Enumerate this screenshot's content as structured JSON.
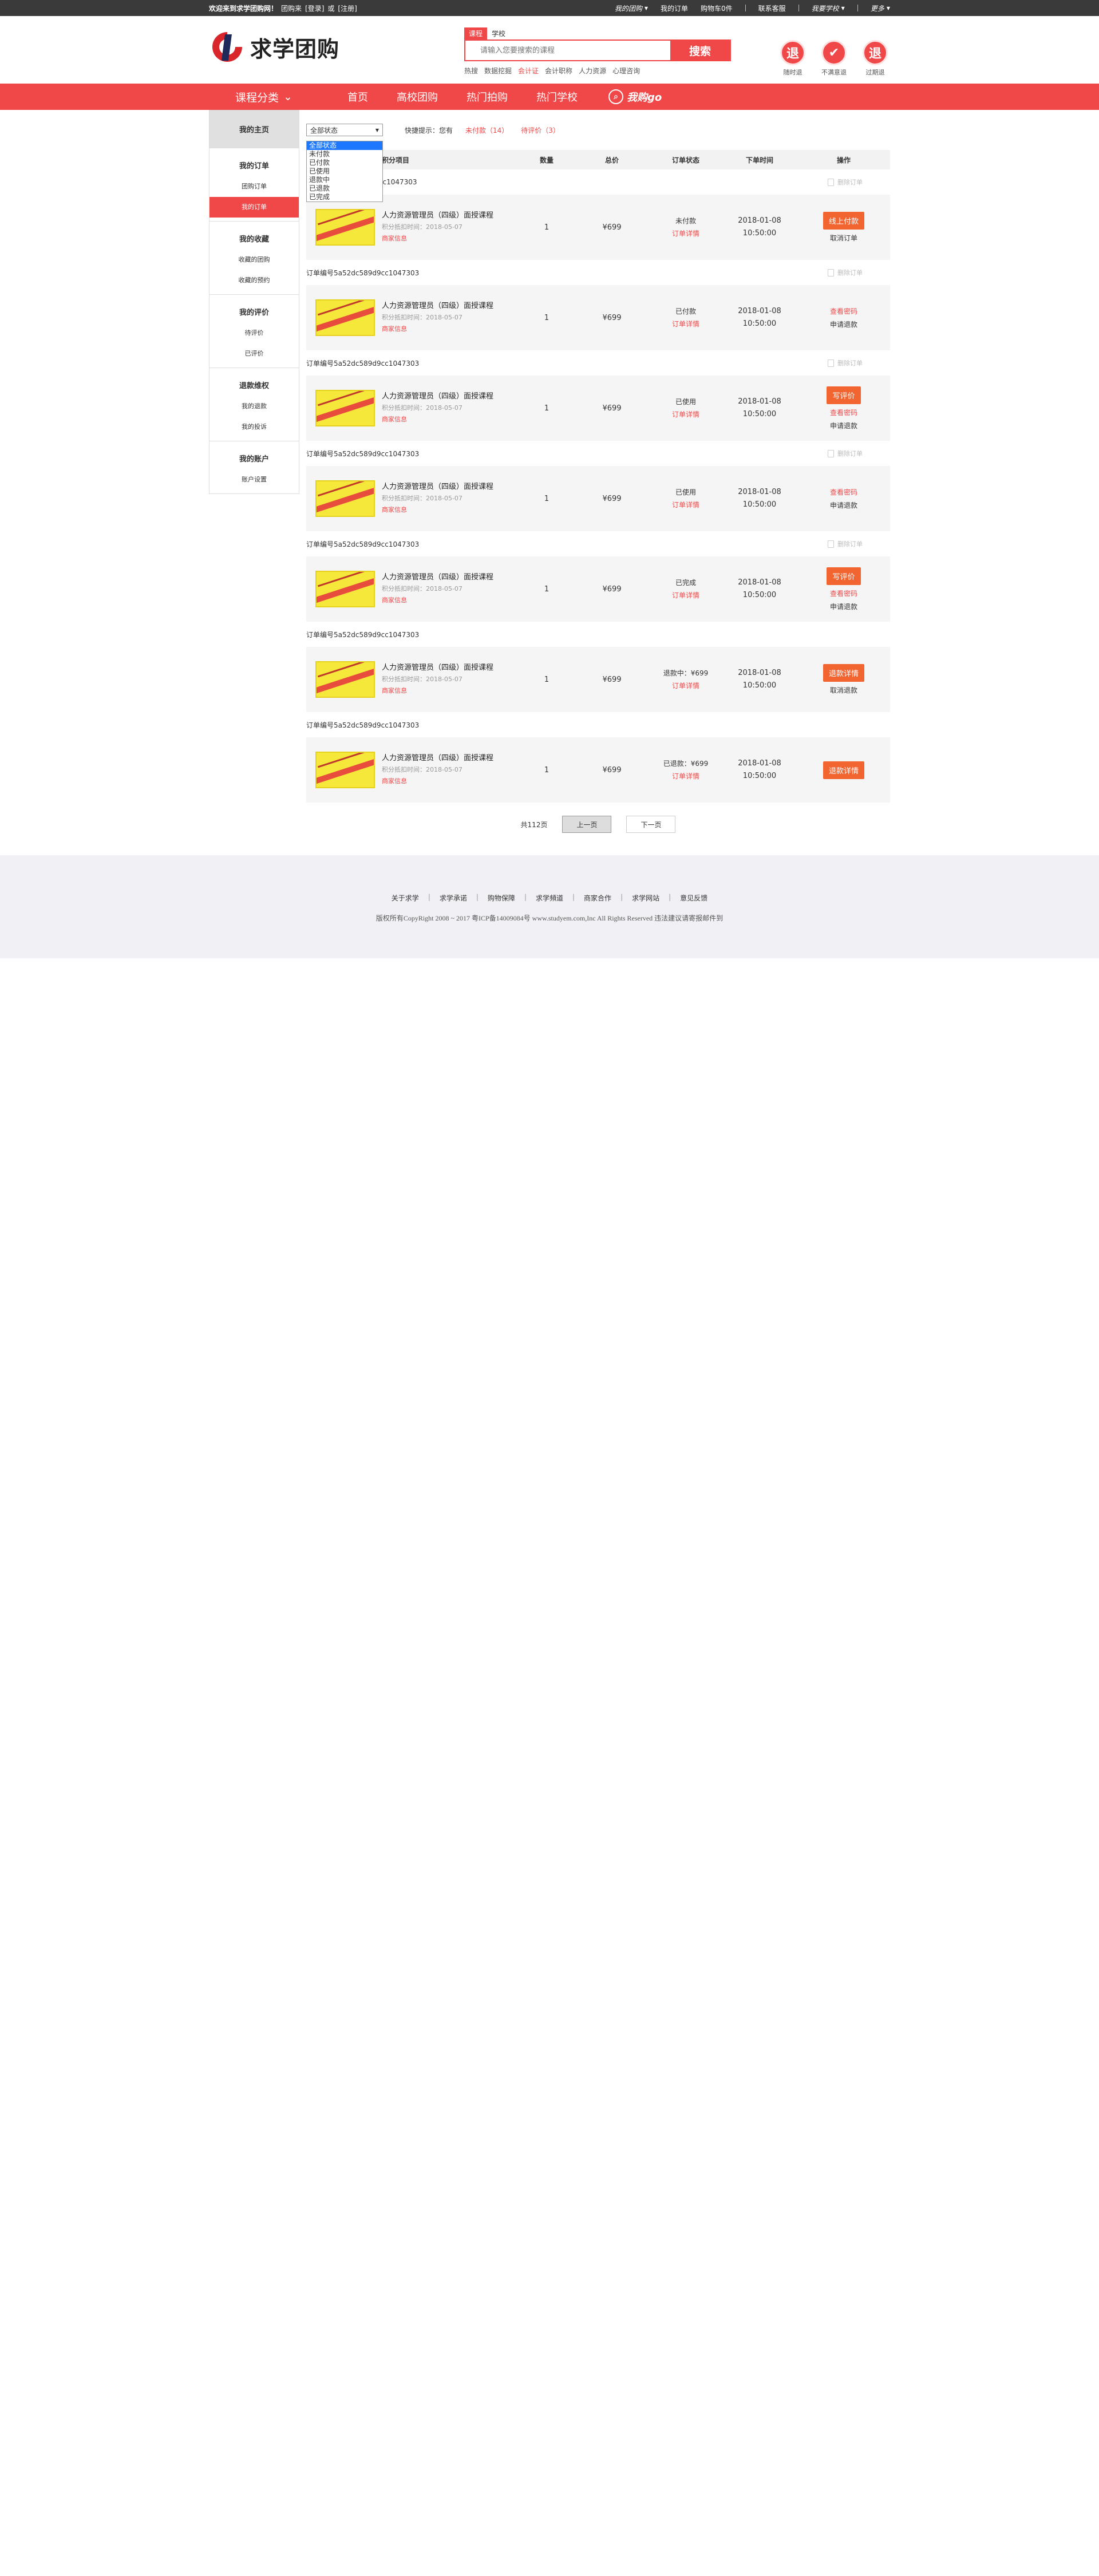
{
  "topbar": {
    "welcome": "欢迎来到求学团购网！",
    "group": "团购来",
    "login": "[登录]",
    "or": "或",
    "register": "[注册]",
    "links": [
      "我的团购",
      "我的订单",
      "购物车0件",
      "联系客服",
      "我要学校",
      "更多"
    ]
  },
  "header": {
    "logo": "求学团购",
    "search": {
      "tab_course": "课程",
      "tab_school": "学校",
      "placeholder": "请输入您要搜索的课程",
      "button": "搜索",
      "hot_label": "热搜",
      "hot": [
        "数据挖掘",
        "会计证",
        "会计职称",
        "人力资源",
        "心理咨询"
      ]
    },
    "badges": [
      "随时退",
      "不满意退",
      "过期退"
    ],
    "badge_glyphs": [
      "退",
      "✔",
      "退"
    ]
  },
  "nav": {
    "category": "课程分类",
    "items": [
      "首页",
      "高校团购",
      "热门拍购",
      "热门学校"
    ],
    "brand": "我购go"
  },
  "sidebar": {
    "home": "我的主页",
    "groups": [
      {
        "title": "我的订单",
        "items": [
          "团购订单",
          "我的订单"
        ]
      },
      {
        "title": "我的收藏",
        "items": [
          "收藏的团购",
          "收藏的预约"
        ]
      },
      {
        "title": "我的评价",
        "items": [
          "待评价",
          "已评价"
        ]
      },
      {
        "title": "退款维权",
        "items": [
          "我的退款",
          "我的投诉"
        ]
      },
      {
        "title": "我的账户",
        "items": [
          "账户设置"
        ]
      }
    ]
  },
  "filter": {
    "selected": "全部状态",
    "options": [
      "全部状态",
      "未付款",
      "已付款",
      "已使用",
      "退款中",
      "已退款",
      "已完成"
    ],
    "tip_label": "快捷提示：您有",
    "unpaid": "未付款（14）",
    "unreviewed": "待评价（3）"
  },
  "table": {
    "headers": [
      "积分项目",
      "数量",
      "总价",
      "订单状态",
      "下单时间",
      "操作"
    ],
    "delete_label": "删除订单"
  },
  "orders": [
    {
      "no": "订单编号5a52dc589d9cc1047303",
      "head_no": "9d9cc1047303",
      "show_delete": true,
      "name": "人力资源管理员（四级）面授课程",
      "time_label": "积分抵扣时间：2018-05-07",
      "merchant": "商家信息",
      "qty": "1",
      "price": "¥699",
      "status": "未付款",
      "detail": "订单详情",
      "date": "2018-01-08",
      "clock": "10:50:00",
      "btn": "线上付款",
      "op2": "取消订单",
      "op3": ""
    },
    {
      "no": "订单编号5a52dc589d9cc1047303",
      "show_delete": true,
      "name": "人力资源管理员（四级）面授课程",
      "time_label": "积分抵扣时间：2018-05-07",
      "merchant": "商家信息",
      "qty": "1",
      "price": "¥699",
      "status": "已付款",
      "detail": "订单详情",
      "date": "2018-01-08",
      "clock": "10:50:00",
      "btn": "",
      "op2": "查看密码",
      "op3": "申请退款"
    },
    {
      "no": "订单编号5a52dc589d9cc1047303",
      "show_delete": true,
      "name": "人力资源管理员（四级）面授课程",
      "time_label": "积分抵扣时间：2018-05-07",
      "merchant": "商家信息",
      "qty": "1",
      "price": "¥699",
      "status": "已使用",
      "detail": "订单详情",
      "date": "2018-01-08",
      "clock": "10:50:00",
      "btn": "写评价",
      "op2": "查看密码",
      "op3": "申请退款"
    },
    {
      "no": "订单编号5a52dc589d9cc1047303",
      "show_delete": true,
      "name": "人力资源管理员（四级）面授课程",
      "time_label": "积分抵扣时间：2018-05-07",
      "merchant": "商家信息",
      "qty": "1",
      "price": "¥699",
      "status": "已使用",
      "detail": "订单详情",
      "date": "2018-01-08",
      "clock": "10:50:00",
      "btn": "",
      "op2": "查看密码",
      "op3": "申请退款"
    },
    {
      "no": "订单编号5a52dc589d9cc1047303",
      "show_delete": true,
      "name": "人力资源管理员（四级）面授课程",
      "time_label": "积分抵扣时间：2018-05-07",
      "merchant": "商家信息",
      "qty": "1",
      "price": "¥699",
      "status": "已完成",
      "detail": "订单详情",
      "date": "2018-01-08",
      "clock": "10:50:00",
      "btn": "写评价",
      "op2": "查看密码",
      "op3": "申请退款"
    },
    {
      "no": "订单编号5a52dc589d9cc1047303",
      "show_delete": false,
      "name": "人力资源管理员（四级）面授课程",
      "time_label": "积分抵扣时间：2018-05-07",
      "merchant": "商家信息",
      "qty": "1",
      "price": "¥699",
      "status": "退款中：¥699",
      "detail": "订单详情",
      "date": "2018-01-08",
      "clock": "10:50:00",
      "btn": "退款详情",
      "op2": "取消退款",
      "op3": ""
    },
    {
      "no": "订单编号5a52dc589d9cc1047303",
      "show_delete": false,
      "name": "人力资源管理员（四级）面授课程",
      "time_label": "积分抵扣时间：2018-05-07",
      "merchant": "商家信息",
      "qty": "1",
      "price": "¥699",
      "status": "已退款：¥699",
      "detail": "订单详情",
      "date": "2018-01-08",
      "clock": "10:50:00",
      "btn": "退款详情",
      "op2": "",
      "op3": ""
    }
  ],
  "pager": {
    "total": "共112页",
    "prev": "上一页",
    "next": "下一页"
  },
  "footer": {
    "links": [
      "关于求学",
      "求学承诺",
      "购物保障",
      "求学頻道",
      "商家合作",
      "求学网站",
      "意见反馈"
    ],
    "copyright": "版权所有CopyRight 2008 ~ 2017 粤ICP备14009084号 www.studyem.com,Inc All Rights Reserved 违法建议请寄报邮件到"
  },
  "colors": {
    "brand": "#f04848",
    "button": "#f26531",
    "topbar": "#3a3a3a"
  }
}
